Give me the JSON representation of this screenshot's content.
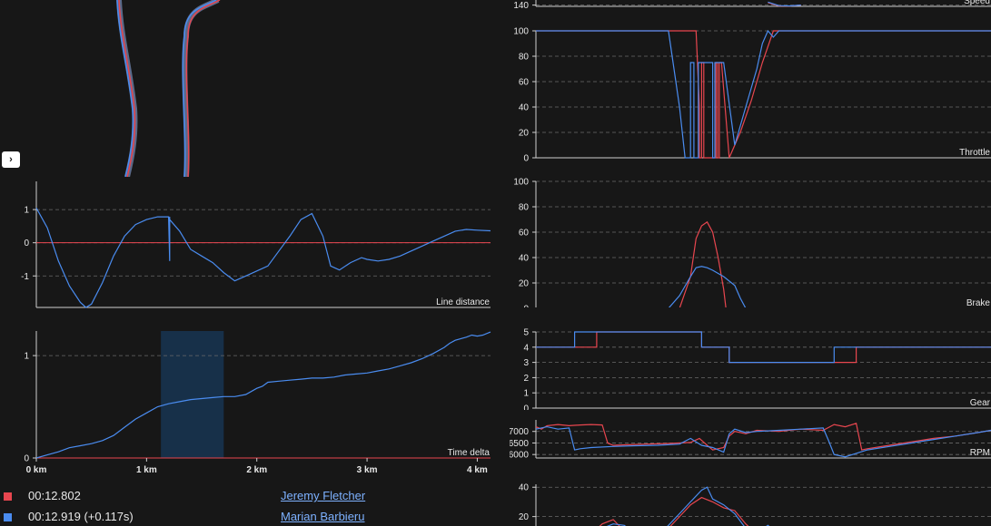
{
  "colors": {
    "driver1": "#e8464f",
    "driver2": "#4a8cf0",
    "background": "#171717",
    "highlight": "#173049"
  },
  "toggle_label": "›",
  "legend": [
    {
      "time": "00:12.802",
      "name": "Jeremy Fletcher",
      "color": "#e8464f"
    },
    {
      "time": "00:12.919 (+0.117s)",
      "name": "Marian Barbieru",
      "color": "#4a8cf0"
    }
  ],
  "chart_data": [
    {
      "id": "line_distance",
      "type": "line",
      "ylabel": "Line distance",
      "yticks": [
        1,
        0,
        -1
      ],
      "ylim": [
        -1.95,
        1.85
      ],
      "xlim": [
        0,
        4.12
      ],
      "reference": {
        "name": "Jeremy Fletcher",
        "y": 0
      },
      "series": [
        {
          "name": "Marian Barbieru",
          "x": [
            0,
            0.1,
            0.2,
            0.3,
            0.4,
            0.45,
            0.5,
            0.6,
            0.7,
            0.8,
            0.9,
            1.0,
            1.1,
            1.2,
            1.21,
            1.21,
            1.21,
            1.3,
            1.4,
            1.5,
            1.6,
            1.7,
            1.8,
            1.9,
            2.0,
            2.1,
            2.2,
            2.3,
            2.4,
            2.5,
            2.6,
            2.67,
            2.75,
            2.85,
            2.95,
            3.0,
            3.1,
            3.2,
            3.3,
            3.4,
            3.5,
            3.6,
            3.7,
            3.8,
            3.9,
            4.0,
            4.12
          ],
          "y": [
            1.05,
            0.45,
            -0.55,
            -1.3,
            -1.8,
            -1.95,
            -1.85,
            -1.2,
            -0.4,
            0.2,
            0.55,
            0.7,
            0.78,
            0.78,
            -0.55,
            0.78,
            0.7,
            0.35,
            -0.2,
            -0.4,
            -0.6,
            -0.9,
            -1.15,
            -1.0,
            -0.85,
            -0.7,
            -0.25,
            0.2,
            0.7,
            0.88,
            0.2,
            -0.7,
            -0.82,
            -0.6,
            -0.45,
            -0.5,
            -0.55,
            -0.5,
            -0.4,
            -0.25,
            -0.1,
            0.05,
            0.2,
            0.35,
            0.4,
            0.38,
            0.36
          ]
        }
      ]
    },
    {
      "id": "time_delta",
      "type": "line",
      "ylabel": "Time delta",
      "yticks": [
        1,
        0
      ],
      "ylim": [
        0,
        1.24
      ],
      "xlim": [
        0,
        4.12
      ],
      "xticks": [
        "0 km",
        "1 km",
        "2 km",
        "3 km",
        "4 km"
      ],
      "highlight_range": [
        1.13,
        1.7
      ],
      "reference": {
        "name": "Jeremy Fletcher",
        "y": 0
      },
      "series": [
        {
          "name": "Marian Barbieru",
          "x": [
            0,
            0.1,
            0.2,
            0.3,
            0.4,
            0.5,
            0.6,
            0.7,
            0.8,
            0.9,
            1.0,
            1.1,
            1.2,
            1.3,
            1.4,
            1.5,
            1.6,
            1.7,
            1.8,
            1.9,
            2.0,
            2.05,
            2.1,
            2.2,
            2.3,
            2.4,
            2.5,
            2.6,
            2.7,
            2.8,
            2.9,
            3.0,
            3.1,
            3.2,
            3.3,
            3.4,
            3.5,
            3.6,
            3.7,
            3.75,
            3.8,
            3.9,
            3.95,
            4.0,
            4.05,
            4.12
          ],
          "y": [
            0,
            0.03,
            0.06,
            0.1,
            0.12,
            0.14,
            0.17,
            0.22,
            0.3,
            0.38,
            0.44,
            0.5,
            0.53,
            0.55,
            0.57,
            0.58,
            0.59,
            0.6,
            0.6,
            0.62,
            0.68,
            0.7,
            0.74,
            0.75,
            0.76,
            0.77,
            0.78,
            0.78,
            0.79,
            0.81,
            0.82,
            0.83,
            0.85,
            0.87,
            0.9,
            0.93,
            0.97,
            1.02,
            1.08,
            1.12,
            1.15,
            1.18,
            1.2,
            1.19,
            1.2,
            1.23
          ]
        }
      ]
    },
    {
      "id": "speed",
      "type": "line",
      "ylabel": "Speed",
      "yticks": [
        140
      ],
      "ylim": [
        135,
        175
      ],
      "xlim": [
        0,
        4.12
      ],
      "series": [
        {
          "name": "Jeremy Fletcher",
          "x": [
            2.1,
            2.2,
            2.3,
            2.4
          ],
          "y": [
            150,
            137,
            136,
            140
          ]
        },
        {
          "name": "Marian Barbieru",
          "x": [
            2.1,
            2.2,
            2.3,
            2.4
          ],
          "y": [
            152,
            138,
            137,
            140
          ]
        }
      ]
    },
    {
      "id": "throttle",
      "type": "line",
      "ylabel": "Throttle",
      "yticks": [
        100,
        80,
        60,
        40,
        20,
        0
      ],
      "ylim": [
        0,
        100
      ],
      "xlim": [
        0,
        4.12
      ],
      "series": [
        {
          "name": "Jeremy Fletcher",
          "x": [
            0,
            1.45,
            1.48,
            1.48,
            1.5,
            1.5,
            1.52,
            1.52,
            1.63,
            1.63,
            1.645,
            1.645,
            1.66,
            1.66,
            1.68,
            1.75,
            1.85,
            1.95,
            2.05,
            2.15,
            4.12
          ],
          "y": [
            100,
            100,
            40,
            0,
            0,
            75,
            75,
            0,
            0,
            75,
            75,
            0,
            0,
            75,
            75,
            0,
            20,
            45,
            75,
            100,
            100
          ]
        },
        {
          "name": "Marian Barbieru",
          "x": [
            0,
            1.2,
            1.3,
            1.35,
            1.4,
            1.4,
            1.43,
            1.43,
            1.47,
            1.47,
            1.6,
            1.6,
            1.62,
            1.62,
            1.7,
            1.8,
            1.9,
            2.0,
            2.05,
            2.1,
            2.15,
            2.2,
            2.25,
            4.12
          ],
          "y": [
            100,
            100,
            40,
            0,
            0,
            75,
            75,
            0,
            0,
            75,
            75,
            0,
            0,
            75,
            75,
            10,
            40,
            70,
            90,
            100,
            95,
            100,
            100,
            100
          ]
        }
      ]
    },
    {
      "id": "brake",
      "type": "line",
      "ylabel": "Brake",
      "yticks": [
        100,
        80,
        60,
        40,
        20,
        0
      ],
      "ylim": [
        0,
        100
      ],
      "xlim": [
        0,
        4.12
      ],
      "series": [
        {
          "name": "Jeremy Fletcher",
          "x": [
            1.3,
            1.4,
            1.45,
            1.5,
            1.55,
            1.6,
            1.65,
            1.7,
            1.72
          ],
          "y": [
            0,
            25,
            55,
            65,
            68,
            60,
            40,
            15,
            0
          ]
        },
        {
          "name": "Marian Barbieru",
          "x": [
            1.2,
            1.3,
            1.4,
            1.45,
            1.5,
            1.55,
            1.6,
            1.7,
            1.8,
            1.85,
            1.9
          ],
          "y": [
            0,
            10,
            25,
            32,
            33,
            32,
            30,
            25,
            18,
            8,
            0
          ]
        }
      ]
    },
    {
      "id": "gear",
      "type": "line",
      "ylabel": "Gear",
      "yticks": [
        5,
        4,
        3,
        2,
        1,
        0
      ],
      "ylim": [
        0,
        5
      ],
      "xlim": [
        0,
        4.12
      ],
      "series": [
        {
          "name": "Jeremy Fletcher",
          "x": [
            0,
            0.55,
            0.55,
            1.5,
            1.5,
            1.75,
            1.75,
            2.9,
            2.9,
            4.12
          ],
          "y": [
            4,
            4,
            5,
            5,
            4,
            4,
            3,
            3,
            4,
            4
          ]
        },
        {
          "name": "Marian Barbieru",
          "x": [
            0,
            0.35,
            0.35,
            1.5,
            1.5,
            1.75,
            1.75,
            2.7,
            2.7,
            4.12
          ],
          "y": [
            4,
            4,
            5,
            5,
            4,
            4,
            3,
            3,
            4,
            4
          ]
        }
      ]
    },
    {
      "id": "rpm",
      "type": "line",
      "ylabel": "RPM",
      "yticks": [
        7000,
        6500,
        6000
      ],
      "ylim": [
        5850,
        7500
      ],
      "xlim": [
        0,
        4.12
      ],
      "series": [
        {
          "name": "Jeremy Fletcher",
          "x": [
            0,
            0.05,
            0.1,
            0.2,
            0.3,
            0.4,
            0.5,
            0.6,
            0.65,
            0.7,
            0.8,
            1.0,
            1.2,
            1.4,
            1.48,
            1.55,
            1.6,
            1.7,
            1.75,
            1.8,
            1.9,
            2.0,
            2.2,
            2.4,
            2.6,
            2.7,
            2.8,
            2.9,
            2.95,
            3.0,
            3.2,
            3.4,
            3.6,
            3.8,
            4.0,
            4.12
          ],
          "y": [
            7200,
            7100,
            7250,
            7300,
            7250,
            7280,
            7300,
            7280,
            6500,
            6400,
            6420,
            6450,
            6480,
            6520,
            6700,
            6400,
            6200,
            6300,
            6800,
            7000,
            6900,
            7050,
            7000,
            7100,
            7050,
            7300,
            7200,
            7350,
            6200,
            6250,
            6400,
            6550,
            6700,
            6800,
            6950,
            7050
          ]
        },
        {
          "name": "Marian Barbieru",
          "x": [
            0,
            0.1,
            0.2,
            0.3,
            0.35,
            0.4,
            0.5,
            0.7,
            0.9,
            1.1,
            1.3,
            1.4,
            1.45,
            1.5,
            1.6,
            1.7,
            1.75,
            1.8,
            1.9,
            2.0,
            2.2,
            2.4,
            2.6,
            2.65,
            2.7,
            2.8,
            2.9,
            3.0,
            3.2,
            3.4,
            3.6,
            3.8,
            4.0,
            4.12
          ],
          "y": [
            7100,
            7200,
            7100,
            7150,
            6200,
            6250,
            6300,
            6350,
            6380,
            6400,
            6450,
            6700,
            6550,
            6400,
            6300,
            6100,
            6900,
            7100,
            6950,
            7000,
            7050,
            7100,
            7150,
            6600,
            6000,
            5900,
            6050,
            6200,
            6350,
            6500,
            6650,
            6800,
            6950,
            7050
          ]
        }
      ]
    },
    {
      "id": "bottom",
      "type": "line",
      "ylabel": "",
      "yticks": [
        40,
        20
      ],
      "ylim": [
        0,
        42
      ],
      "xlim": [
        0,
        4.12
      ],
      "series": [
        {
          "name": "Jeremy Fletcher",
          "x": [
            0.3,
            0.5,
            0.6,
            0.7,
            0.8,
            0.9,
            1.0,
            1.1,
            1.2,
            1.3,
            1.4,
            1.5,
            1.6,
            1.7,
            1.8,
            1.9,
            2.0,
            2.1,
            2.2,
            2.4,
            2.6,
            2.8,
            3.0,
            3.2,
            3.4,
            3.6,
            3.8
          ],
          "y": [
            3,
            8,
            15,
            18,
            10,
            8,
            5,
            8,
            12,
            20,
            28,
            33,
            30,
            26,
            24,
            15,
            8,
            10,
            6,
            4,
            5,
            3,
            4,
            6,
            5,
            3,
            4
          ]
        },
        {
          "name": "Marian Barbieru",
          "x": [
            0.3,
            0.5,
            0.6,
            0.7,
            0.8,
            0.9,
            1.0,
            1.1,
            1.2,
            1.3,
            1.4,
            1.5,
            1.55,
            1.6,
            1.7,
            1.8,
            1.9,
            2.0,
            2.1,
            2.2,
            2.4,
            2.6,
            2.8,
            3.0,
            3.2,
            3.4,
            3.6,
            3.8
          ],
          "y": [
            2,
            6,
            12,
            15,
            14,
            8,
            6,
            7,
            14,
            22,
            30,
            38,
            40,
            32,
            28,
            22,
            12,
            9,
            14,
            8,
            5,
            6,
            4,
            5,
            7,
            4,
            3,
            5
          ]
        }
      ]
    }
  ]
}
